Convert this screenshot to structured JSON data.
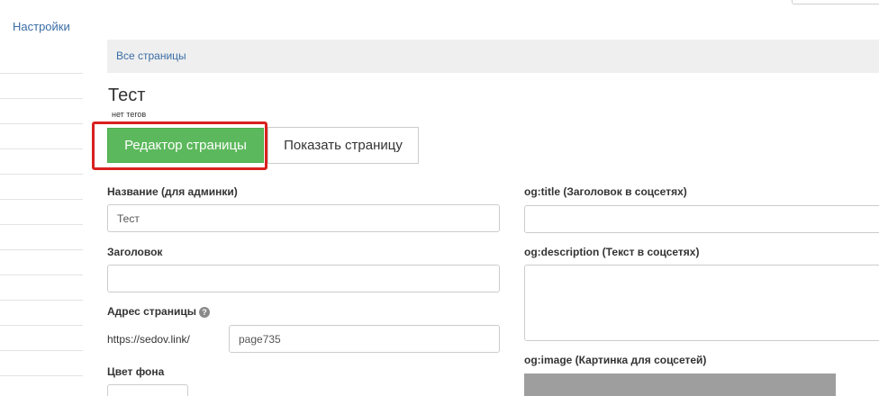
{
  "nav": {
    "settings_link": "Настройки"
  },
  "breadcrumb": {
    "all_pages": "Все страницы"
  },
  "page": {
    "title": "Тест",
    "tags": "нет тегов"
  },
  "buttons": {
    "editor": "Редактор страницы",
    "show": "Показать страницу"
  },
  "form_left": {
    "name_label": "Название (для админки)",
    "name_value": "Тест",
    "heading_label": "Заголовок",
    "heading_value": "",
    "address_label": "Адрес страницы",
    "address_prefix": "https://sedov.link/",
    "address_value": "page735",
    "bg_color_label": "Цвет фона"
  },
  "form_right": {
    "og_title_label": "og:title (Заголовок в соцсетях)",
    "og_title_value": "",
    "og_description_label": "og:description (Текст в соцсетях)",
    "og_description_value": "",
    "og_image_label": "og:image (Картинка для соцсетей)"
  },
  "icons": {
    "help": "question-circle-icon"
  },
  "colors": {
    "primary_green": "#5cb85c",
    "highlight_red": "#d9201f",
    "link_blue": "#3a6da5"
  }
}
